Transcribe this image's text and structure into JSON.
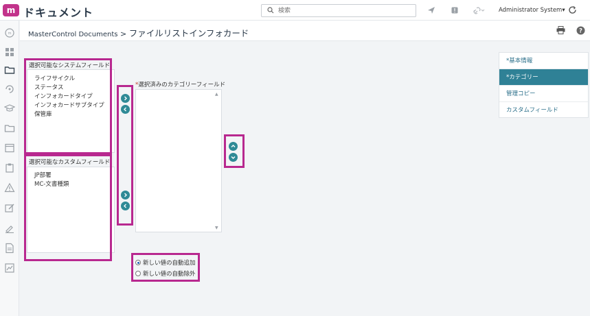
{
  "app": {
    "logo_text": "m",
    "title": "ドキュメント"
  },
  "header": {
    "search_placeholder": "検索",
    "user": "Administrator System▾"
  },
  "breadcrumb": {
    "root": "MasterControl Documents",
    "separator": ">",
    "current": "ファイルリストインフォカード"
  },
  "system_fields": {
    "title": "選択可能なシステムフィールド",
    "items": [
      "ライフサイクル",
      "ステータス",
      "インフォカードタイプ",
      "インフォカードサブタイプ",
      "保管庫"
    ]
  },
  "custom_fields": {
    "title": "選択可能なカスタムフィールド",
    "items": [
      "JP部署",
      "MC-文書種類"
    ]
  },
  "selected_fields": {
    "title": "選択済みのカテゴリーフィールド",
    "required_mark": "*"
  },
  "right_nav": {
    "items": [
      {
        "label": "*基本情報",
        "active": false
      },
      {
        "label": "*カテゴリー",
        "active": true
      },
      {
        "label": "管理コピー",
        "active": false
      },
      {
        "label": "カスタムフィールド",
        "active": false
      }
    ]
  },
  "auto_options": {
    "add": {
      "label": "新しい値の自動追加",
      "checked": true
    },
    "exclude": {
      "label": "新しい値の自動除外",
      "checked": false
    }
  },
  "colors": {
    "accent": "#2f8196",
    "highlight": "#b8288f",
    "logo": "#c2338b"
  }
}
